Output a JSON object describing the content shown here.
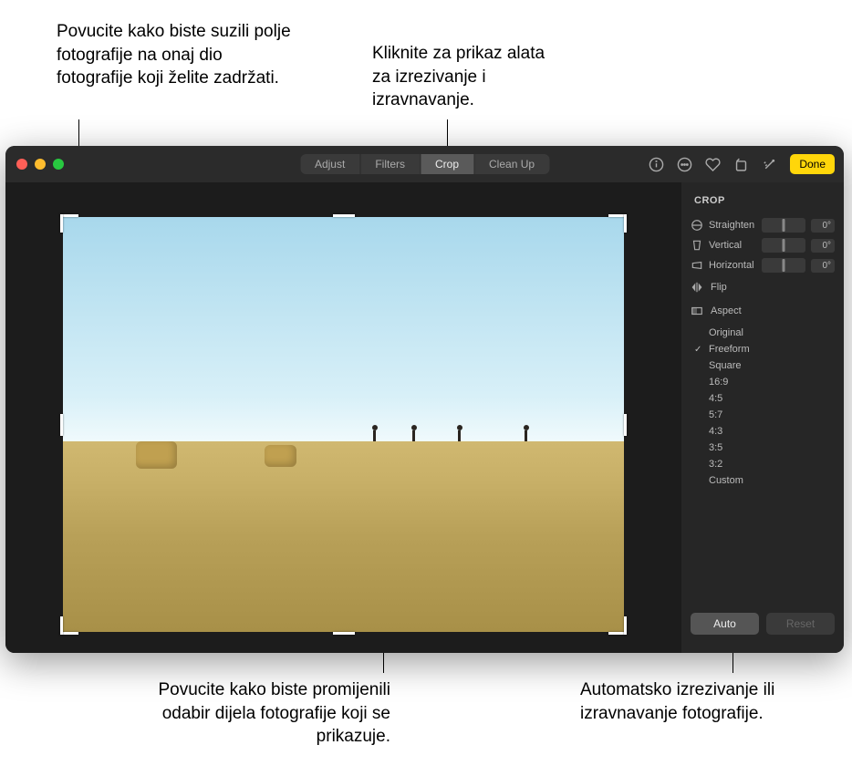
{
  "callouts": {
    "topLeft": "Povucite kako biste suzili polje fotografije na onaj dio fotografije koji želite zadržati.",
    "topRight": "Kliknite za prikaz alata za izrezivanje i izravnavanje.",
    "bottomLeft": "Povucite kako biste promijenili odabir dijela fotografije koji se prikazuje.",
    "bottomRight": "Automatsko izrezivanje ili izravnavanje fotografije."
  },
  "toolbar": {
    "tabs": [
      "Adjust",
      "Filters",
      "Crop",
      "Clean Up"
    ],
    "activeTab": "Crop",
    "done": "Done"
  },
  "sidebar": {
    "title": "CROP",
    "sliders": [
      {
        "label": "Straighten",
        "value": "0°"
      },
      {
        "label": "Vertical",
        "value": "0°"
      },
      {
        "label": "Horizontal",
        "value": "0°"
      }
    ],
    "flip": "Flip",
    "aspect": "Aspect",
    "aspectOptions": [
      "Original",
      "Freeform",
      "Square",
      "16:9",
      "4:5",
      "5:7",
      "4:3",
      "3:5",
      "3:2",
      "Custom"
    ],
    "aspectSelected": "Freeform",
    "auto": "Auto",
    "reset": "Reset"
  }
}
